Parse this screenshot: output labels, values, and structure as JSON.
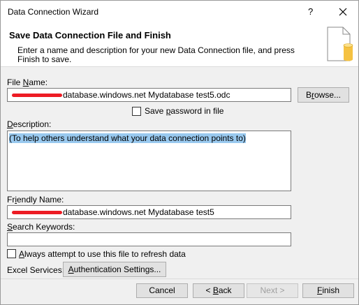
{
  "window": {
    "title": "Data Connection Wizard",
    "help": "?",
    "close_icon": "close-icon"
  },
  "header": {
    "title": "Save Data Connection File and Finish",
    "description": "Enter a name and description for your new Data Connection file, and press Finish to save.",
    "icon": "document-database-icon"
  },
  "file_name": {
    "label_pre": "File ",
    "label_key": "N",
    "label_post": "ame:",
    "value": "database.windows.net Mydatabase test5.odc",
    "browse_pre": "B",
    "browse_key": "r",
    "browse_post": "owse..."
  },
  "save_password": {
    "label_pre": "Save ",
    "label_key": "p",
    "label_post": "assword in file",
    "checked": false
  },
  "description": {
    "label_key": "D",
    "label_post": "escription:",
    "value": "(To help others understand what your data connection points to)"
  },
  "friendly_name": {
    "label_pre": "Fr",
    "label_key": "i",
    "label_post": "endly Name:",
    "value": "database.windows.net Mydatabase test5"
  },
  "search_keywords": {
    "label_key": "S",
    "label_post": "earch Keywords:",
    "value": ""
  },
  "always_attempt": {
    "label_key": "A",
    "label_post": "lways attempt to use this file to refresh data",
    "checked": false
  },
  "excel_services": {
    "label": "Excel Services:",
    "button_key": "A",
    "button_post": "uthentication Settings..."
  },
  "footer": {
    "cancel": "Cancel",
    "back_pre": "< ",
    "back_key": "B",
    "back_post": "ack",
    "next": "Next >",
    "finish_key": "F",
    "finish_post": "inish"
  }
}
